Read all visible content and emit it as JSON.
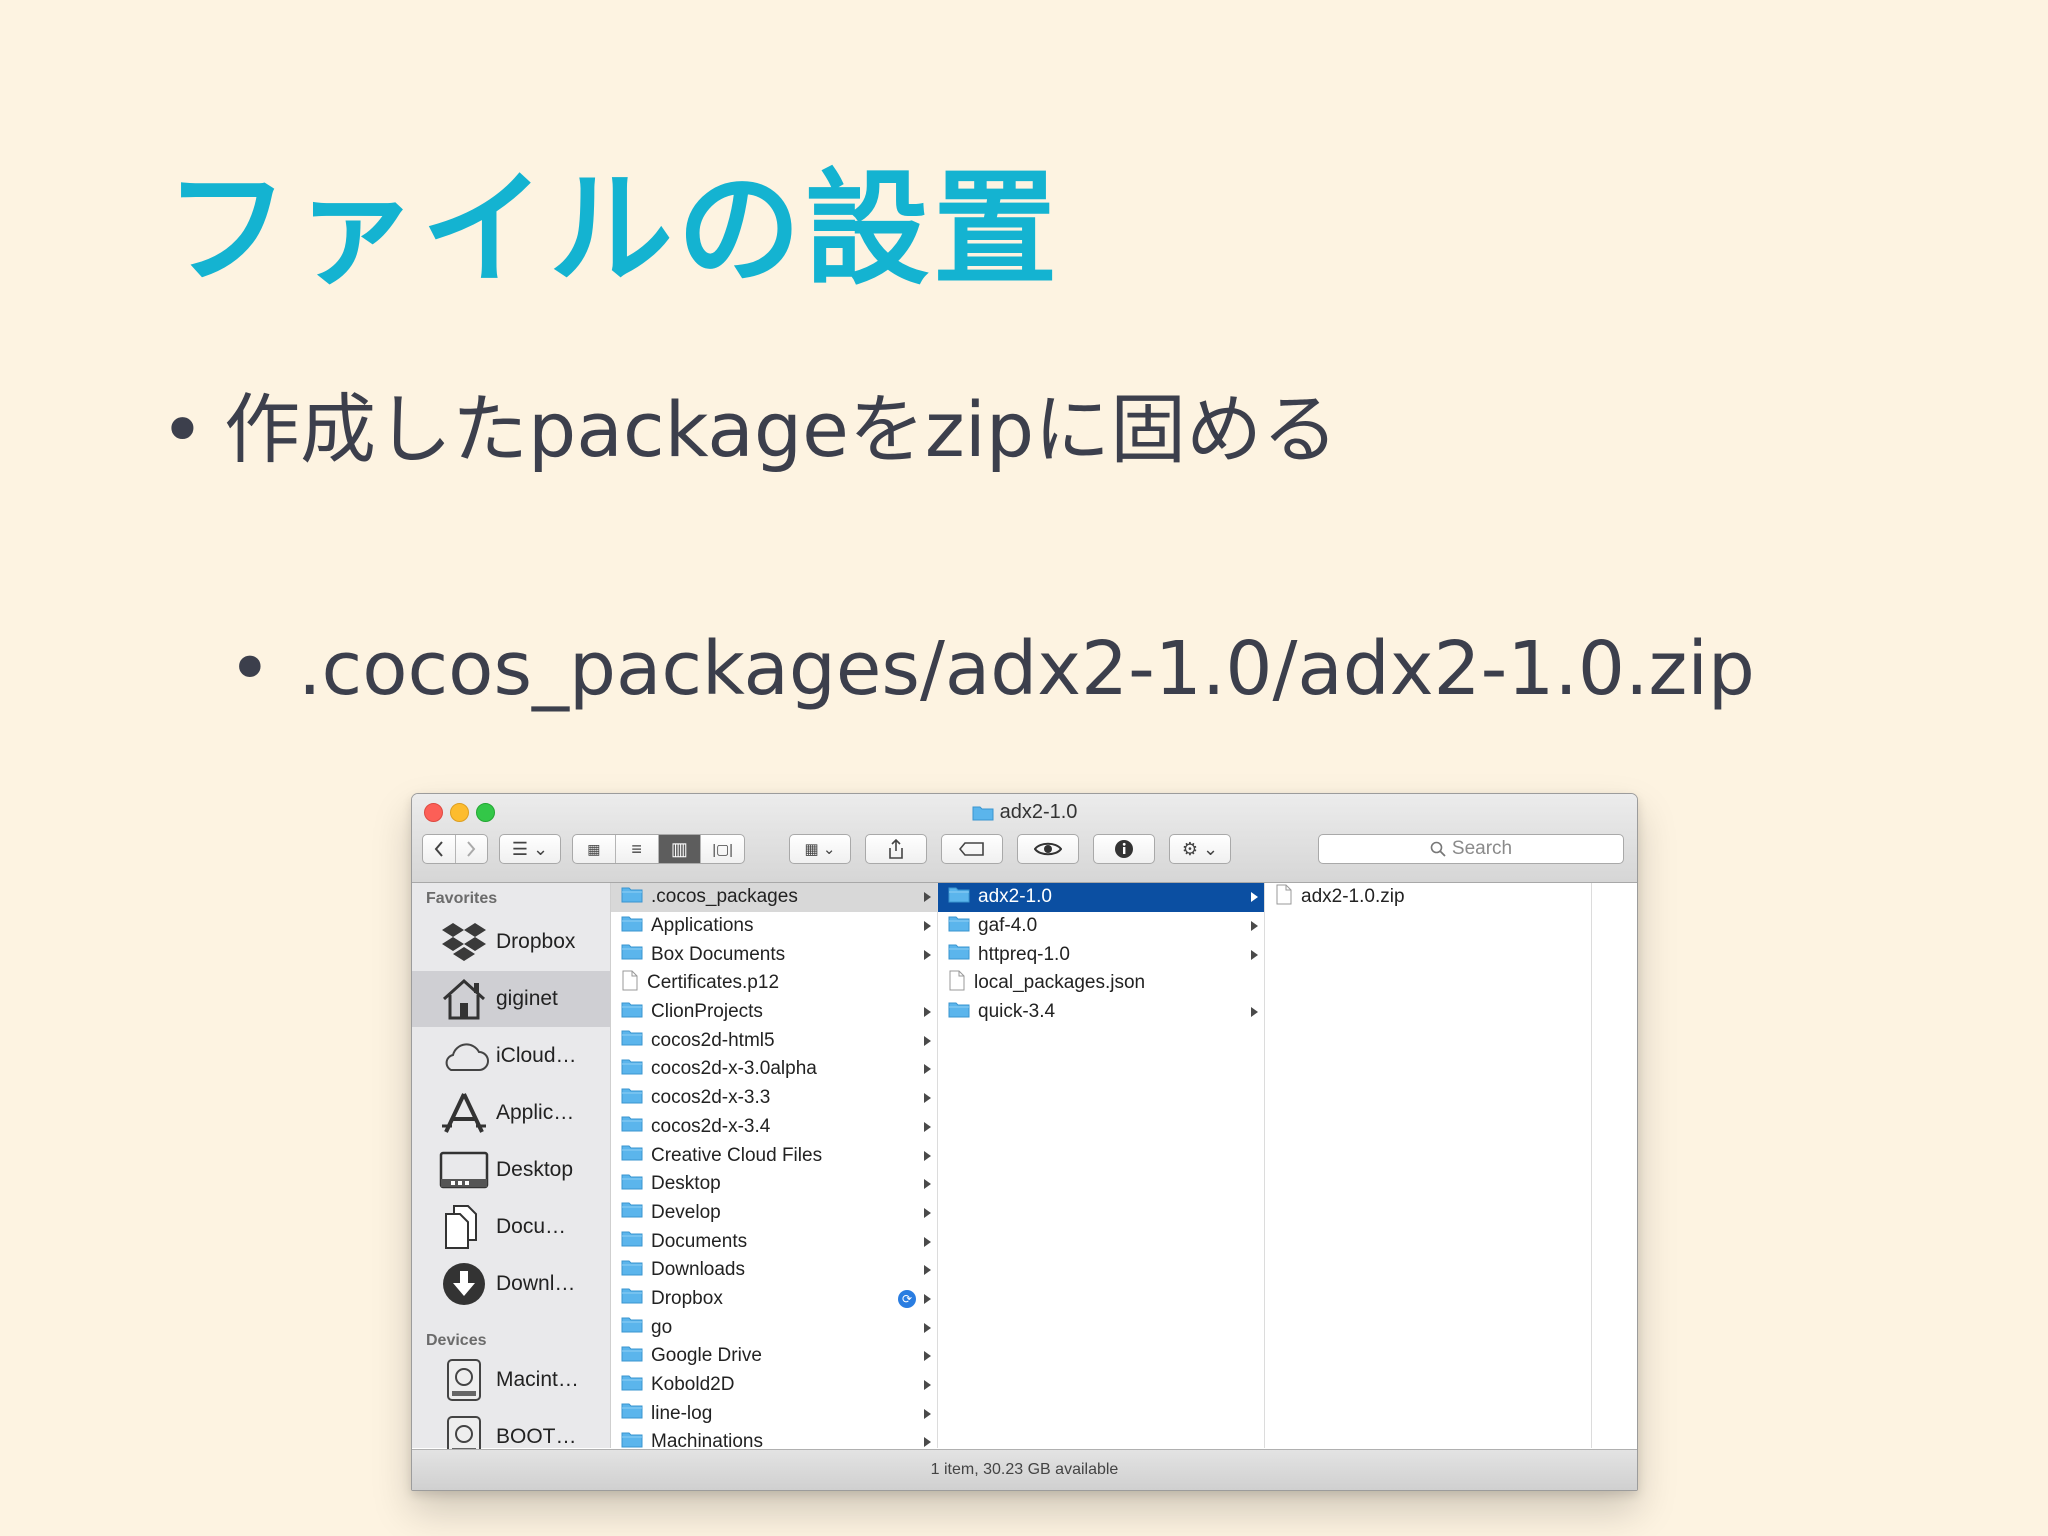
{
  "slide": {
    "title": "ファイルの設置",
    "bullet1": "作成したpackageをzipに固める",
    "bullet2": ".cocos_packages/adx2-1.0/adx2-1.0.zip"
  },
  "finder": {
    "window_title": "adx2-1.0",
    "search_placeholder": "Search",
    "sidebar": {
      "favorites_heading": "Favorites",
      "favorites": [
        {
          "label": "Dropbox",
          "icon": "dropbox-icon"
        },
        {
          "label": "giginet",
          "icon": "home-icon",
          "selected": true
        },
        {
          "label": "iCloud…",
          "icon": "cloud-icon"
        },
        {
          "label": "Applic…",
          "icon": "applications-icon"
        },
        {
          "label": "Desktop",
          "icon": "desktop-icon"
        },
        {
          "label": "Docu…",
          "icon": "documents-icon"
        },
        {
          "label": "Downl…",
          "icon": "downloads-icon"
        }
      ],
      "devices_heading": "Devices",
      "devices": [
        {
          "label": "Macint…",
          "icon": "hard-drive-icon"
        },
        {
          "label": "BOOT…",
          "icon": "hard-drive-icon"
        }
      ]
    },
    "column1": [
      {
        "name": ".cocos_packages",
        "folder": true,
        "arrow": true,
        "state": "grey"
      },
      {
        "name": "Applications",
        "folder": true,
        "arrow": true
      },
      {
        "name": "Box Documents",
        "folder": true,
        "arrow": true
      },
      {
        "name": "Certificates.p12",
        "folder": false,
        "arrow": false
      },
      {
        "name": "ClionProjects",
        "folder": true,
        "arrow": true
      },
      {
        "name": "cocos2d-html5",
        "folder": true,
        "arrow": true
      },
      {
        "name": "cocos2d-x-3.0alpha",
        "folder": true,
        "arrow": true
      },
      {
        "name": "cocos2d-x-3.3",
        "folder": true,
        "arrow": true
      },
      {
        "name": "cocos2d-x-3.4",
        "folder": true,
        "arrow": true
      },
      {
        "name": "Creative Cloud Files",
        "folder": true,
        "arrow": true
      },
      {
        "name": "Desktop",
        "folder": true,
        "arrow": true
      },
      {
        "name": "Develop",
        "folder": true,
        "arrow": true
      },
      {
        "name": "Documents",
        "folder": true,
        "arrow": true
      },
      {
        "name": "Downloads",
        "folder": true,
        "arrow": true
      },
      {
        "name": "Dropbox",
        "folder": true,
        "arrow": true,
        "sync": true
      },
      {
        "name": "go",
        "folder": true,
        "arrow": true
      },
      {
        "name": "Google Drive",
        "folder": true,
        "arrow": true
      },
      {
        "name": "Kobold2D",
        "folder": true,
        "arrow": true
      },
      {
        "name": "line-log",
        "folder": true,
        "arrow": true
      },
      {
        "name": "Machinations",
        "folder": true,
        "arrow": true
      }
    ],
    "column2": [
      {
        "name": "adx2-1.0",
        "folder": true,
        "arrow": true,
        "state": "blue"
      },
      {
        "name": "gaf-4.0",
        "folder": true,
        "arrow": true
      },
      {
        "name": "httpreq-1.0",
        "folder": true,
        "arrow": true
      },
      {
        "name": "local_packages.json",
        "folder": false,
        "arrow": false
      },
      {
        "name": "quick-3.4",
        "folder": true,
        "arrow": true
      }
    ],
    "column3": [
      {
        "name": "adx2-1.0.zip",
        "folder": false,
        "arrow": false
      }
    ],
    "status": "1 item, 30.23 GB available",
    "colors": {
      "selection": "#0b4fa2",
      "folder": "#5bb5ec"
    }
  }
}
